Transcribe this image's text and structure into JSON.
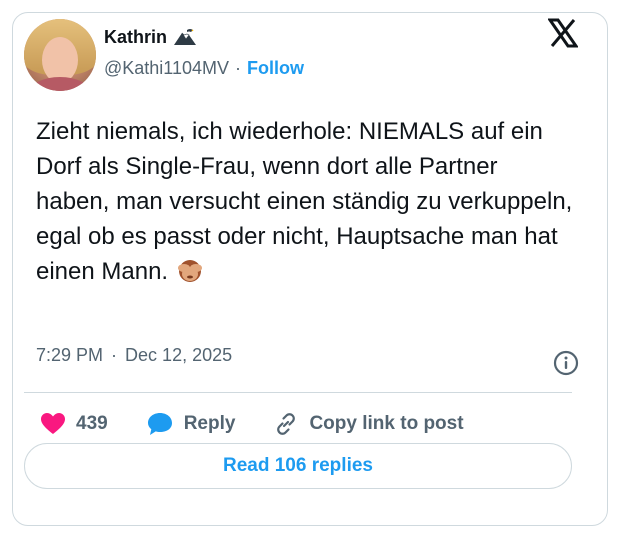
{
  "author": {
    "display_name": "Kathrin",
    "handle": "@Kathi1104MV",
    "separator": "·",
    "follow_label": "Follow"
  },
  "tweet": {
    "text": "Zieht niemals, ich wiederhole: NIEMALS auf ein Dorf als Single-Frau, wenn dort alle Partner haben, man versucht einen ständig zu verkuppeln, egal ob es passt oder nicht, Hauptsache man hat einen Mann.",
    "time": "7:29 PM",
    "separator": "·",
    "date": "Dec 12, 2025"
  },
  "actions": {
    "like_count": "439",
    "reply_label": "Reply",
    "copy_label": "Copy link to post"
  },
  "read_replies_label": "Read 106 replies",
  "icons": {
    "like": "heart-icon",
    "reply": "speech-bubble-icon",
    "copy": "link-icon",
    "info": "info-icon",
    "brand": "x-logo-icon",
    "badge": "eagle-icon",
    "emoji": "see-no-evil-monkey-emoji"
  },
  "colors": {
    "accent": "#1d9bf0",
    "like": "#f91880",
    "text": "#0f1419",
    "muted": "#536471",
    "border": "#cfd9de"
  }
}
